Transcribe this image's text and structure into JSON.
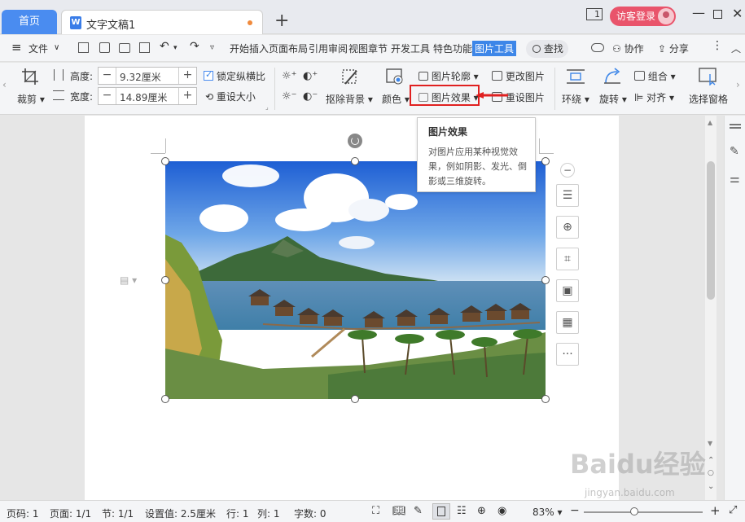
{
  "tabs": {
    "home": "首页",
    "doc_title": "文字文稿1",
    "add": "+"
  },
  "window": {
    "page_count_icon": "1",
    "login": "访客登录"
  },
  "menu": {
    "file": "文件",
    "items": [
      "开始",
      "插入",
      "页面布局",
      "引用",
      "审阅",
      "视图",
      "章节",
      "开发工具",
      "特色功能"
    ],
    "active": "图片工具",
    "search": "查找",
    "collab": "协作",
    "share": "分享"
  },
  "ribbon": {
    "crop": "裁剪",
    "height_label": "高度:",
    "height_value": "9.32厘米",
    "width_label": "宽度:",
    "width_value": "14.89厘米",
    "lock_ratio": "锁定纵横比",
    "reset_size": "重设大小",
    "remove_bg": "抠除背景",
    "color": "颜色",
    "pic_outline": "图片轮廓",
    "change_pic": "更改图片",
    "pic_effect": "图片效果",
    "reset_pic": "重设图片",
    "wrap": "环绕",
    "rotate": "旋转",
    "group": "组合",
    "align": "对齐",
    "select_pane": "选择窗格"
  },
  "tooltip": {
    "title": "图片效果",
    "body": "对图片应用某种视觉效果，例如阴影、发光、倒影或三维旋转。"
  },
  "status": {
    "page_num": "页码: 1",
    "pages": "页面: 1/1",
    "section": "节: 1/1",
    "setting": "设置值: 2.5厘米",
    "row": "行: 1",
    "col": "列: 1",
    "words": "字数: 0",
    "zoom": "83%"
  },
  "watermark": {
    "brand": "Baidu经验",
    "url": "jingyan.baidu.com"
  },
  "colors": {
    "accent": "#3d86e8",
    "login": "#e9546b",
    "highlight": "#e02020"
  }
}
